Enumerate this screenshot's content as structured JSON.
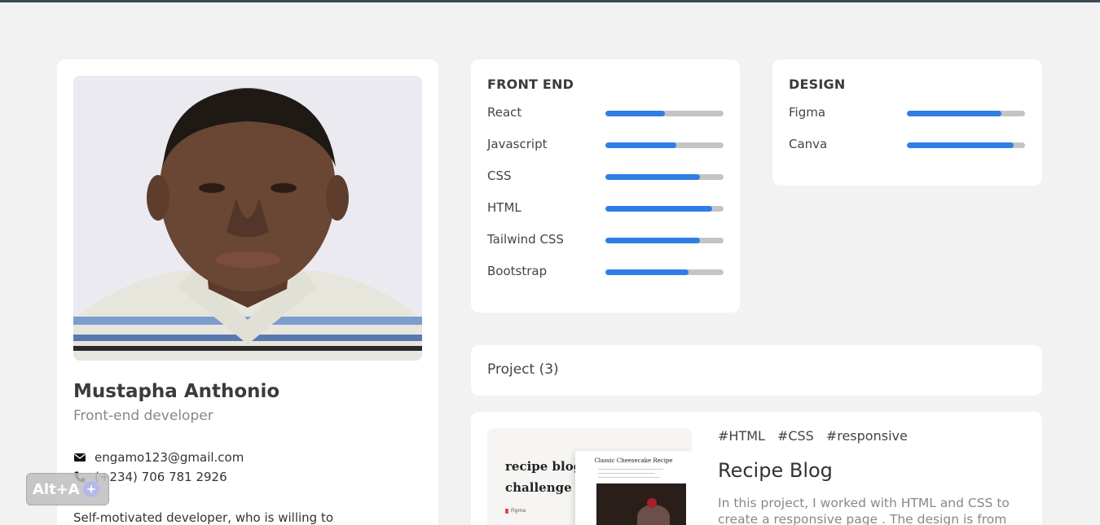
{
  "profile": {
    "name": "Mustapha Anthonio",
    "role": "Front-end developer",
    "email": "engamo123@gmail.com",
    "phone": "(+234) 706 781 2926",
    "bio": "Self-motivated developer, who is willing to"
  },
  "frontend": {
    "title": "FRONT END",
    "skills": [
      {
        "name": "React",
        "level": 0.5
      },
      {
        "name": "Javascript",
        "level": 0.6
      },
      {
        "name": "CSS",
        "level": 0.8
      },
      {
        "name": "HTML",
        "level": 0.9
      },
      {
        "name": "Tailwind CSS",
        "level": 0.8
      },
      {
        "name": "Bootstrap",
        "level": 0.7
      }
    ]
  },
  "design": {
    "title": "DESIGN",
    "skills": [
      {
        "name": "Figma",
        "level": 0.8
      },
      {
        "name": "Canva",
        "level": 0.9
      }
    ]
  },
  "projects": {
    "header": "Project (3)",
    "items": [
      {
        "tags": [
          "#HTML",
          "#CSS",
          "#responsive"
        ],
        "title": "Recipe Blog",
        "description": "In this project, I worked with HTML and CSS to create a responsive page . The design is from",
        "thumbnail": {
          "heading_line1": "recipe blog",
          "heading_line2": "challenge",
          "brand": "Figma",
          "page_title": "Classic Cheesecake Recipe"
        }
      }
    ]
  },
  "badge": {
    "label": "Alt+A"
  },
  "colors": {
    "accent": "#2f7ee6",
    "track": "#c4c4c4",
    "background": "#f2f2f2"
  },
  "icons": {
    "email": "envelope-icon",
    "phone": "phone-icon",
    "badge": "sparkle-icon"
  }
}
